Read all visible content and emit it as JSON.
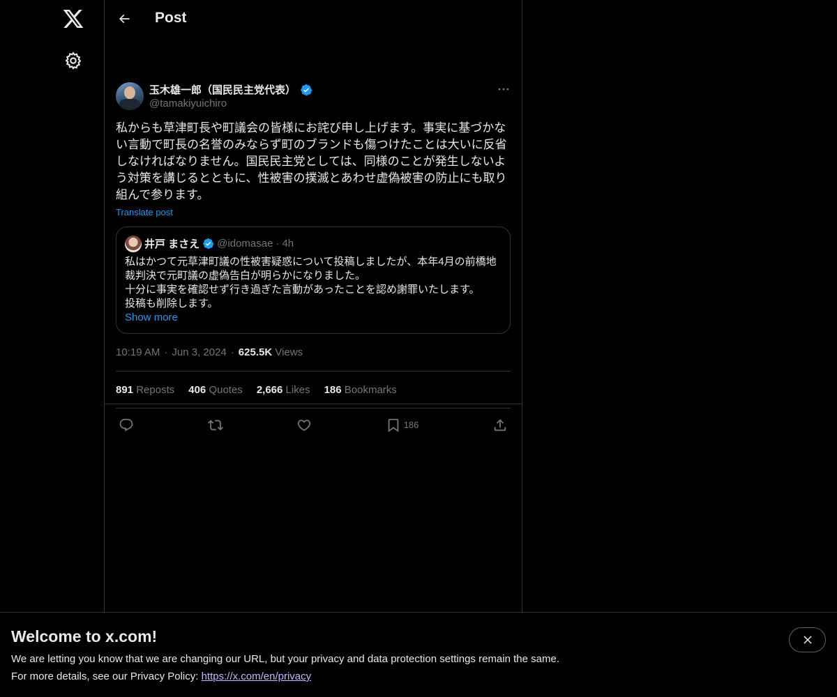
{
  "nav": {
    "logo_icon": "x-logo-icon",
    "settings_icon": "gear-icon"
  },
  "header": {
    "title": "Post"
  },
  "post": {
    "author": {
      "display_name": "玉木雄一郎（国民民主党代表）",
      "handle": "@tamakiyuichiro",
      "verified": true
    },
    "text": "私からも草津町長や町議会の皆様にお詫び申し上げます。事実に基づかない言動で町長の名誉のみならず町のブランドも傷つけたことは大いに反省しなければなりません。国民民主党としては、同様のことが発生しないよう対策を講じるとともに、性被害の撲滅とあわせ虚偽被害の防止にも取り組んで参ります。",
    "translate_label": "Translate post",
    "quote": {
      "display_name": "井戸 まさえ",
      "handle": "@idomasae",
      "dot": "·",
      "time": "4h",
      "text": "私はかつて元草津町議の性被害疑惑について投稿しましたが、本年4月の前橋地裁判決で元町議の虚偽告白が明らかになりました。\n十分に事実を確認せず行き過ぎた言動があったことを認め謝罪いたします。\n投稿も削除します。",
      "show_more": "Show more"
    },
    "meta": {
      "time": "10:19 AM",
      "sep1": "·",
      "date": "Jun 3, 2024",
      "sep2": "·",
      "views_count": "625.5K",
      "views_label": "Views"
    },
    "stats": {
      "reposts_count": "891",
      "reposts_label": "Reposts",
      "quotes_count": "406",
      "quotes_label": "Quotes",
      "likes_count": "2,666",
      "likes_label": "Likes",
      "bookmarks_count": "186",
      "bookmarks_label": "Bookmarks"
    },
    "actions": {
      "bookmark_count": "186"
    }
  },
  "banner": {
    "title": "Welcome to x.com!",
    "line1": "We are letting you know that we are changing our URL, but your privacy and data protection settings remain the same.",
    "line2_prefix": "For more details, see our Privacy Policy: ",
    "link": "https://x.com/en/privacy"
  },
  "colors": {
    "background": "#000000",
    "text": "#e7e9ea",
    "muted": "#71767b",
    "accent": "#1d9bf0",
    "border": "#2f3336",
    "verified": "#1d9bf0"
  }
}
